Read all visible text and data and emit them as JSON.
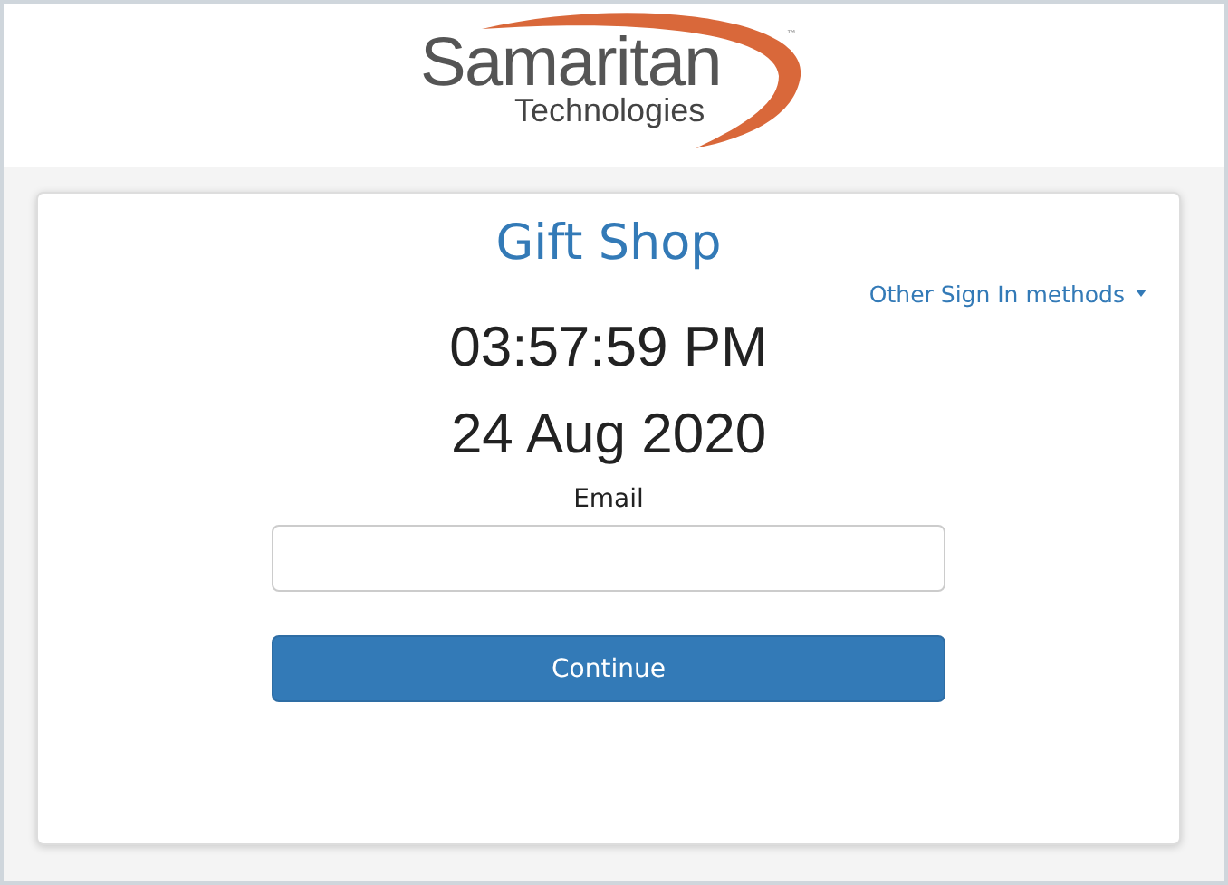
{
  "logo": {
    "name": "Samaritan",
    "trademark": "™",
    "tagline": "Technologies"
  },
  "card": {
    "title": "Gift Shop",
    "sign_in_menu": {
      "label": "Other Sign In methods",
      "expanded": false
    },
    "time": "03:57:59 PM",
    "date": "24 Aug 2020",
    "email_field": {
      "label": "Email"
    },
    "button": "Continue"
  }
}
